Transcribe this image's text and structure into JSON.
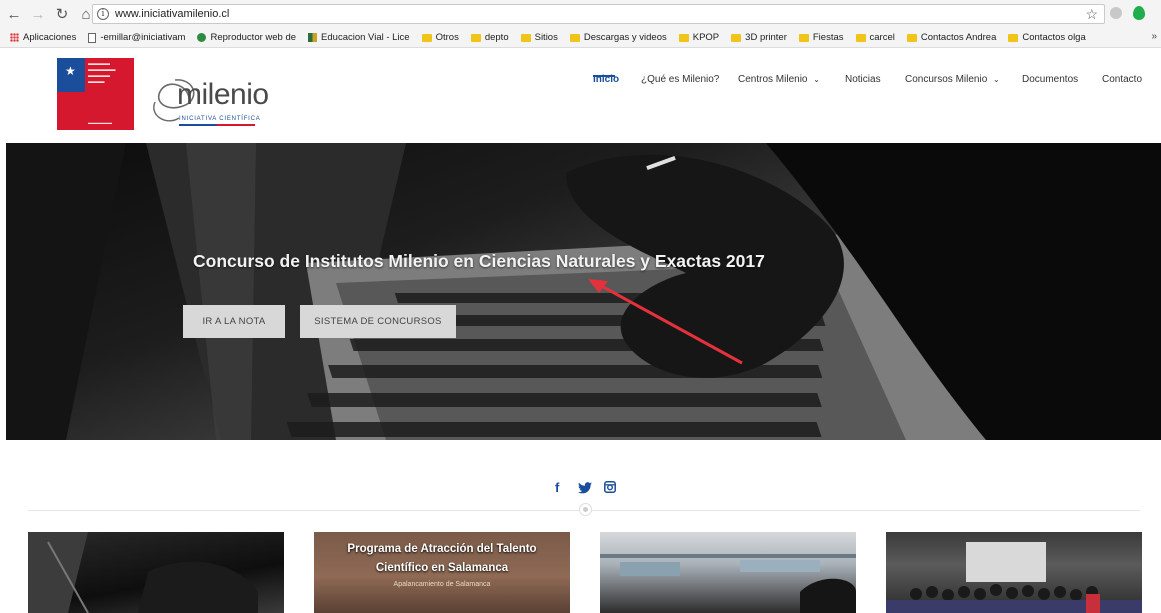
{
  "browser": {
    "url": "www.iniciativamilenio.cl",
    "bookmarks": [
      {
        "label": "Aplicaciones",
        "icon": "apps"
      },
      {
        "label": "-emillar@iniciativam",
        "icon": "page"
      },
      {
        "label": "Reproductor web de",
        "icon": "green"
      },
      {
        "label": "Educacion Vial - Lice",
        "icon": "flag"
      },
      {
        "label": "Otros",
        "icon": "folder"
      },
      {
        "label": "depto",
        "icon": "folder"
      },
      {
        "label": "Sitios",
        "icon": "folder"
      },
      {
        "label": "Descargas y videos",
        "icon": "folder"
      },
      {
        "label": "KPOP",
        "icon": "folder"
      },
      {
        "label": "3D printer",
        "icon": "folder"
      },
      {
        "label": "Fiestas",
        "icon": "folder"
      },
      {
        "label": "carcel",
        "icon": "folder"
      },
      {
        "label": "Contactos Andrea",
        "icon": "folder"
      },
      {
        "label": "Contactos olga",
        "icon": "folder"
      }
    ]
  },
  "logo": {
    "word": "milenio",
    "tagline": "INICIATIVA CIENTÍFICA"
  },
  "nav": {
    "items": [
      {
        "label": "Inicio",
        "active": true
      },
      {
        "label": "¿Qué es Milenio?"
      },
      {
        "label": "Centros Milenio",
        "dropdown": true
      },
      {
        "label": "Noticias"
      },
      {
        "label": "Concursos Milenio",
        "dropdown": true
      },
      {
        "label": "Documentos"
      },
      {
        "label": "Contacto"
      }
    ]
  },
  "hero": {
    "title": "Concurso de Institutos Milenio en Ciencias Naturales y Exactas 2017",
    "buttons": [
      "IR A LA NOTA",
      "SISTEMA DE CONCURSOS"
    ],
    "arrow_color": "#e3323b"
  },
  "social": {
    "facebook": "f",
    "twitter": "twitter-icon",
    "instagram": "instagram-icon"
  },
  "cards": [
    {
      "title_line1": "",
      "title_line2": "",
      "subtitle": ""
    },
    {
      "title_line1": "Programa de Atracción del Talento",
      "title_line2": "Científico en Salamanca",
      "subtitle": "Apalancamiento de Salamanca"
    },
    {
      "title_line1": "",
      "title_line2": "",
      "subtitle": ""
    },
    {
      "title_line1": "",
      "title_line2": "",
      "subtitle": ""
    }
  ],
  "colors": {
    "brand_blue": "#1a4e9a",
    "brand_red": "#d5182d"
  }
}
